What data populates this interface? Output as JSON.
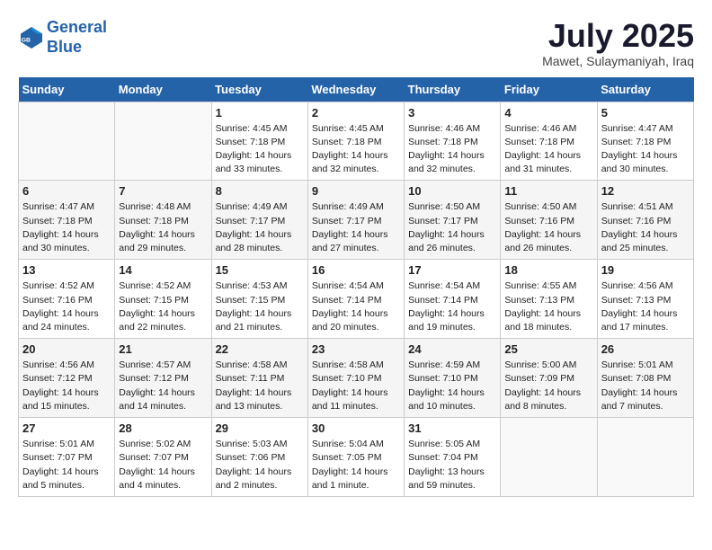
{
  "header": {
    "logo_line1": "General",
    "logo_line2": "Blue",
    "title": "July 2025",
    "subtitle": "Mawet, Sulaymaniyah, Iraq"
  },
  "weekdays": [
    "Sunday",
    "Monday",
    "Tuesday",
    "Wednesday",
    "Thursday",
    "Friday",
    "Saturday"
  ],
  "weeks": [
    [
      {
        "day": "",
        "info": ""
      },
      {
        "day": "",
        "info": ""
      },
      {
        "day": "1",
        "info": "Sunrise: 4:45 AM\nSunset: 7:18 PM\nDaylight: 14 hours\nand 33 minutes."
      },
      {
        "day": "2",
        "info": "Sunrise: 4:45 AM\nSunset: 7:18 PM\nDaylight: 14 hours\nand 32 minutes."
      },
      {
        "day": "3",
        "info": "Sunrise: 4:46 AM\nSunset: 7:18 PM\nDaylight: 14 hours\nand 32 minutes."
      },
      {
        "day": "4",
        "info": "Sunrise: 4:46 AM\nSunset: 7:18 PM\nDaylight: 14 hours\nand 31 minutes."
      },
      {
        "day": "5",
        "info": "Sunrise: 4:47 AM\nSunset: 7:18 PM\nDaylight: 14 hours\nand 30 minutes."
      }
    ],
    [
      {
        "day": "6",
        "info": "Sunrise: 4:47 AM\nSunset: 7:18 PM\nDaylight: 14 hours\nand 30 minutes."
      },
      {
        "day": "7",
        "info": "Sunrise: 4:48 AM\nSunset: 7:18 PM\nDaylight: 14 hours\nand 29 minutes."
      },
      {
        "day": "8",
        "info": "Sunrise: 4:49 AM\nSunset: 7:17 PM\nDaylight: 14 hours\nand 28 minutes."
      },
      {
        "day": "9",
        "info": "Sunrise: 4:49 AM\nSunset: 7:17 PM\nDaylight: 14 hours\nand 27 minutes."
      },
      {
        "day": "10",
        "info": "Sunrise: 4:50 AM\nSunset: 7:17 PM\nDaylight: 14 hours\nand 26 minutes."
      },
      {
        "day": "11",
        "info": "Sunrise: 4:50 AM\nSunset: 7:16 PM\nDaylight: 14 hours\nand 26 minutes."
      },
      {
        "day": "12",
        "info": "Sunrise: 4:51 AM\nSunset: 7:16 PM\nDaylight: 14 hours\nand 25 minutes."
      }
    ],
    [
      {
        "day": "13",
        "info": "Sunrise: 4:52 AM\nSunset: 7:16 PM\nDaylight: 14 hours\nand 24 minutes."
      },
      {
        "day": "14",
        "info": "Sunrise: 4:52 AM\nSunset: 7:15 PM\nDaylight: 14 hours\nand 22 minutes."
      },
      {
        "day": "15",
        "info": "Sunrise: 4:53 AM\nSunset: 7:15 PM\nDaylight: 14 hours\nand 21 minutes."
      },
      {
        "day": "16",
        "info": "Sunrise: 4:54 AM\nSunset: 7:14 PM\nDaylight: 14 hours\nand 20 minutes."
      },
      {
        "day": "17",
        "info": "Sunrise: 4:54 AM\nSunset: 7:14 PM\nDaylight: 14 hours\nand 19 minutes."
      },
      {
        "day": "18",
        "info": "Sunrise: 4:55 AM\nSunset: 7:13 PM\nDaylight: 14 hours\nand 18 minutes."
      },
      {
        "day": "19",
        "info": "Sunrise: 4:56 AM\nSunset: 7:13 PM\nDaylight: 14 hours\nand 17 minutes."
      }
    ],
    [
      {
        "day": "20",
        "info": "Sunrise: 4:56 AM\nSunset: 7:12 PM\nDaylight: 14 hours\nand 15 minutes."
      },
      {
        "day": "21",
        "info": "Sunrise: 4:57 AM\nSunset: 7:12 PM\nDaylight: 14 hours\nand 14 minutes."
      },
      {
        "day": "22",
        "info": "Sunrise: 4:58 AM\nSunset: 7:11 PM\nDaylight: 14 hours\nand 13 minutes."
      },
      {
        "day": "23",
        "info": "Sunrise: 4:58 AM\nSunset: 7:10 PM\nDaylight: 14 hours\nand 11 minutes."
      },
      {
        "day": "24",
        "info": "Sunrise: 4:59 AM\nSunset: 7:10 PM\nDaylight: 14 hours\nand 10 minutes."
      },
      {
        "day": "25",
        "info": "Sunrise: 5:00 AM\nSunset: 7:09 PM\nDaylight: 14 hours\nand 8 minutes."
      },
      {
        "day": "26",
        "info": "Sunrise: 5:01 AM\nSunset: 7:08 PM\nDaylight: 14 hours\nand 7 minutes."
      }
    ],
    [
      {
        "day": "27",
        "info": "Sunrise: 5:01 AM\nSunset: 7:07 PM\nDaylight: 14 hours\nand 5 minutes."
      },
      {
        "day": "28",
        "info": "Sunrise: 5:02 AM\nSunset: 7:07 PM\nDaylight: 14 hours\nand 4 minutes."
      },
      {
        "day": "29",
        "info": "Sunrise: 5:03 AM\nSunset: 7:06 PM\nDaylight: 14 hours\nand 2 minutes."
      },
      {
        "day": "30",
        "info": "Sunrise: 5:04 AM\nSunset: 7:05 PM\nDaylight: 14 hours\nand 1 minute."
      },
      {
        "day": "31",
        "info": "Sunrise: 5:05 AM\nSunset: 7:04 PM\nDaylight: 13 hours\nand 59 minutes."
      },
      {
        "day": "",
        "info": ""
      },
      {
        "day": "",
        "info": ""
      }
    ]
  ]
}
